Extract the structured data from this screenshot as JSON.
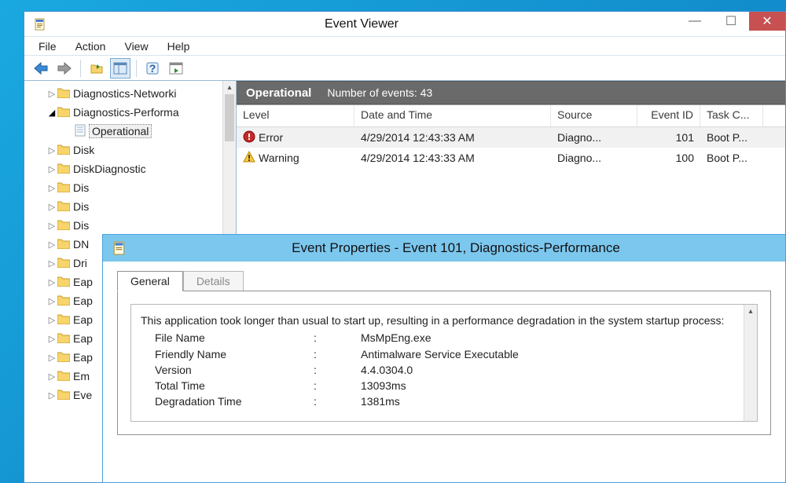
{
  "main_window": {
    "title": "Event Viewer",
    "menus": [
      "File",
      "Action",
      "View",
      "Help"
    ]
  },
  "tree": {
    "items": [
      {
        "indent": 1,
        "arrow": "▷",
        "type": "folder",
        "label": "Diagnostics-Networki"
      },
      {
        "indent": 1,
        "arrow": "◢",
        "type": "folder",
        "label": "Diagnostics-Performa",
        "open": true
      },
      {
        "indent": 2,
        "arrow": "",
        "type": "doc",
        "label": "Operational",
        "selected": true
      },
      {
        "indent": 1,
        "arrow": "▷",
        "type": "folder",
        "label": "Disk"
      },
      {
        "indent": 1,
        "arrow": "▷",
        "type": "folder",
        "label": "DiskDiagnostic"
      },
      {
        "indent": 1,
        "arrow": "▷",
        "type": "folder",
        "label": "Dis"
      },
      {
        "indent": 1,
        "arrow": "▷",
        "type": "folder",
        "label": "Dis"
      },
      {
        "indent": 1,
        "arrow": "▷",
        "type": "folder",
        "label": "Dis"
      },
      {
        "indent": 1,
        "arrow": "▷",
        "type": "folder",
        "label": "DN"
      },
      {
        "indent": 1,
        "arrow": "▷",
        "type": "folder",
        "label": "Dri"
      },
      {
        "indent": 1,
        "arrow": "▷",
        "type": "folder",
        "label": "Eap"
      },
      {
        "indent": 1,
        "arrow": "▷",
        "type": "folder",
        "label": "Eap"
      },
      {
        "indent": 1,
        "arrow": "▷",
        "type": "folder",
        "label": "Eap"
      },
      {
        "indent": 1,
        "arrow": "▷",
        "type": "folder",
        "label": "Eap"
      },
      {
        "indent": 1,
        "arrow": "▷",
        "type": "folder",
        "label": "Eap"
      },
      {
        "indent": 1,
        "arrow": "▷",
        "type": "folder",
        "label": "Em"
      },
      {
        "indent": 1,
        "arrow": "▷",
        "type": "folder",
        "label": "Eve"
      }
    ]
  },
  "event_list": {
    "log_name": "Operational",
    "count_label": "Number of events: 43",
    "columns": [
      "Level",
      "Date and Time",
      "Source",
      "Event ID",
      "Task C..."
    ],
    "rows": [
      {
        "level": "Error",
        "icon": "error",
        "dt": "4/29/2014 12:43:33 AM",
        "src": "Diagno...",
        "eid": "101",
        "tc": "Boot P...",
        "sel": true
      },
      {
        "level": "Warning",
        "icon": "warning",
        "dt": "4/29/2014 12:43:33 AM",
        "src": "Diagno...",
        "eid": "100",
        "tc": "Boot P..."
      }
    ]
  },
  "event_props": {
    "title": "Event Properties - Event 101, Diagnostics-Performance",
    "tabs": [
      "General",
      "Details"
    ],
    "description": "This application took longer than usual to start up, resulting in a performance degradation in the system startup process:",
    "details": [
      {
        "k": "File Name",
        "v": "MsMpEng.exe"
      },
      {
        "k": "Friendly Name",
        "v": "Antimalware Service Executable"
      },
      {
        "k": "Version",
        "v": "4.4.0304.0"
      },
      {
        "k": "Total Time",
        "v": "13093ms"
      },
      {
        "k": "Degradation Time",
        "v": "1381ms"
      }
    ]
  }
}
